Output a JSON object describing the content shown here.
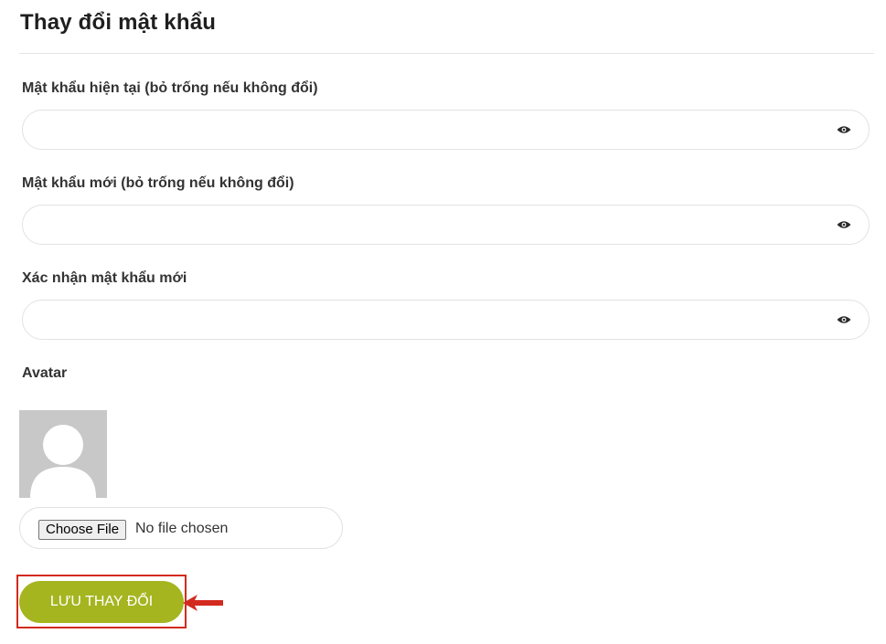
{
  "page": {
    "title": "Thay đổi mật khẩu"
  },
  "fields": {
    "current_password": {
      "label": "Mật khẩu hiện tại (bỏ trống nếu không đổi)",
      "value": "",
      "placeholder": ""
    },
    "new_password": {
      "label": "Mật khẩu mới (bỏ trống nếu không đổi)",
      "value": "",
      "placeholder": ""
    },
    "confirm_password": {
      "label": "Xác nhận mật khẩu mới",
      "value": "",
      "placeholder": ""
    }
  },
  "avatar": {
    "label": "Avatar",
    "file_button_label": "Choose File",
    "file_status": "No file chosen"
  },
  "actions": {
    "save_label": "LƯU THAY ĐỔI"
  },
  "icons": {
    "password_toggle": "eye-icon",
    "avatar_placeholder": "user-silhouette-icon",
    "annotation_arrow": "arrow-left-icon"
  },
  "colors": {
    "save_button": "#a5b520",
    "highlight_border": "#d32a1f",
    "annotation_arrow": "#d32a1f",
    "avatar_background": "#c8c8c8"
  }
}
